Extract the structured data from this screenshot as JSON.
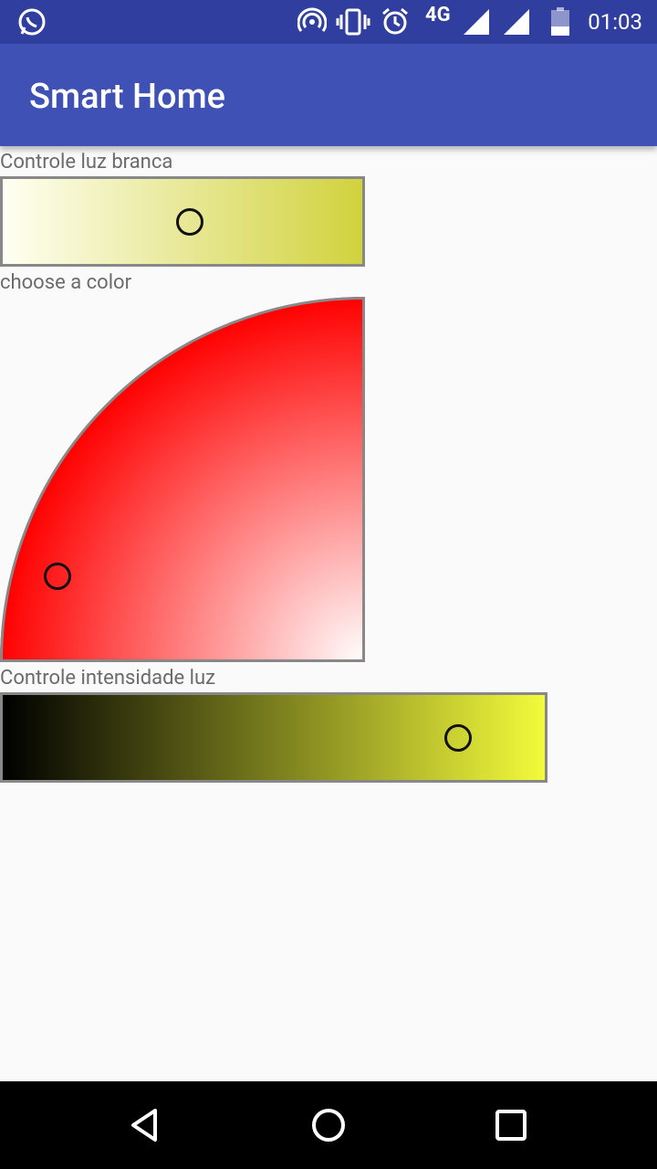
{
  "status_bar": {
    "network": "4G",
    "time": "01:03",
    "icons": [
      "whatsapp-icon",
      "hotspot-icon",
      "vibrate-icon",
      "alarm-icon",
      "signal-icon",
      "signal-icon",
      "battery-icon"
    ]
  },
  "app_bar": {
    "title": "Smart Home"
  },
  "white_light": {
    "label": "Controle luz branca",
    "gradient_start": "#fffff3",
    "gradient_end": "#d1d23d",
    "value": 0.52
  },
  "color_picker": {
    "label": "choose a color"
  },
  "intensity": {
    "label": "Controle intensidade luz",
    "gradient_start": "#000000",
    "gradient_end": "#f3fb3b",
    "value": 0.84
  },
  "nav_bar": {
    "icons": [
      "back-icon",
      "home-icon",
      "recents-icon"
    ]
  }
}
